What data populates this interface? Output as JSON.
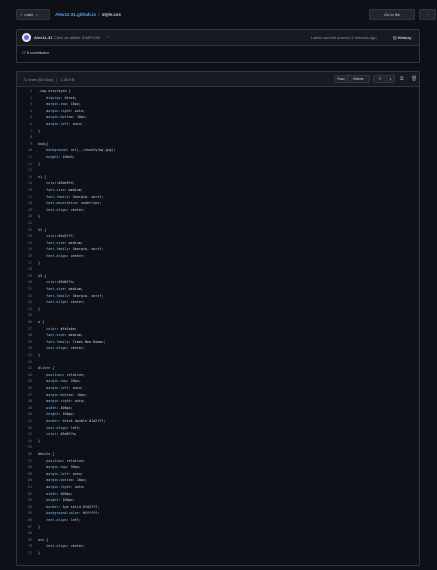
{
  "header": {
    "branch": "main",
    "repo": "Alex11-31.github.io",
    "separator": "/",
    "file": "style.css",
    "goto_label": "Go to file",
    "more_label": "···"
  },
  "commit": {
    "author": "Alex11-31",
    "message": "Cielo de atelier SIMPLON",
    "latest": "Latest commit ecarrcu 2 minutes ago",
    "history_label": "History",
    "contributors_count": "1",
    "contributors_label": "contributor"
  },
  "file": {
    "lines_info": "71 lines (65 sloc)",
    "size": "1.28 KB",
    "raw_label": "Raw",
    "blame_label": "Blame",
    "edit_icon": "pencil-icon",
    "copy_icon": "copy-icon",
    "delete_icon": "trash-icon"
  },
  "code": [
    ".img-displayed {",
    "    display: block;",
    "    margin-top: 10px;",
    "    margin-right: auto;",
    "    margin-bottom: 10px;",
    "    margin-left: auto;",
    "}",
    "",
    "body{",
    "    background: url(../assets/bg.jpg);",
    "    height: 100vh;",
    "}",
    "",
    "h1 {",
    "    color:#3da9f4;",
    "    font-size: medium;",
    "    font-family: Georgia, serif;",
    "    text-decoration: underline;",
    "    text-align: center;",
    "}",
    "",
    "h2 {",
    "    color:#1d2f7f;",
    "    font-size: medium;",
    "    font-family: Georgia, serif;",
    "    text-align: center;",
    "}",
    "",
    "h3 {",
    "    color:#3d6f7a;",
    "    font-size: medium;",
    "    font-family: Georgia, serif;",
    "    text-align: center;",
    "}",
    "",
    "p {",
    "    color: #fe1a6e;",
    "    font-size: medium;",
    "    font-family: Times New Roman;",
    "    text-align: center;",
    "}",
    "",
    "#liste {",
    "    position: relative;",
    "    margin-top: 20px;",
    "    margin-left: auto;",
    "    margin-bottom: 10px;",
    "    margin-right: auto;",
    "    width: 400px;",
    "    height: 100px;",
    "    border: thick double #1d2f7f;",
    "    text-align: left;",
    "    color: #3d6f7a;",
    "}",
    "",
    "#boite {",
    "    position: relative;",
    "    margin-top: 50px;",
    "    margin-left: auto;",
    "    margin-bottom: 10px;",
    "    margin-right: auto;",
    "    width: 400px;",
    "    height: 100px;",
    "    border: 1px solid #1d2f7f;",
    "    background-color: #ffffff;",
    "    text-align: left;",
    "}",
    "",
    "div {",
    "    text-align: center;",
    "}"
  ]
}
